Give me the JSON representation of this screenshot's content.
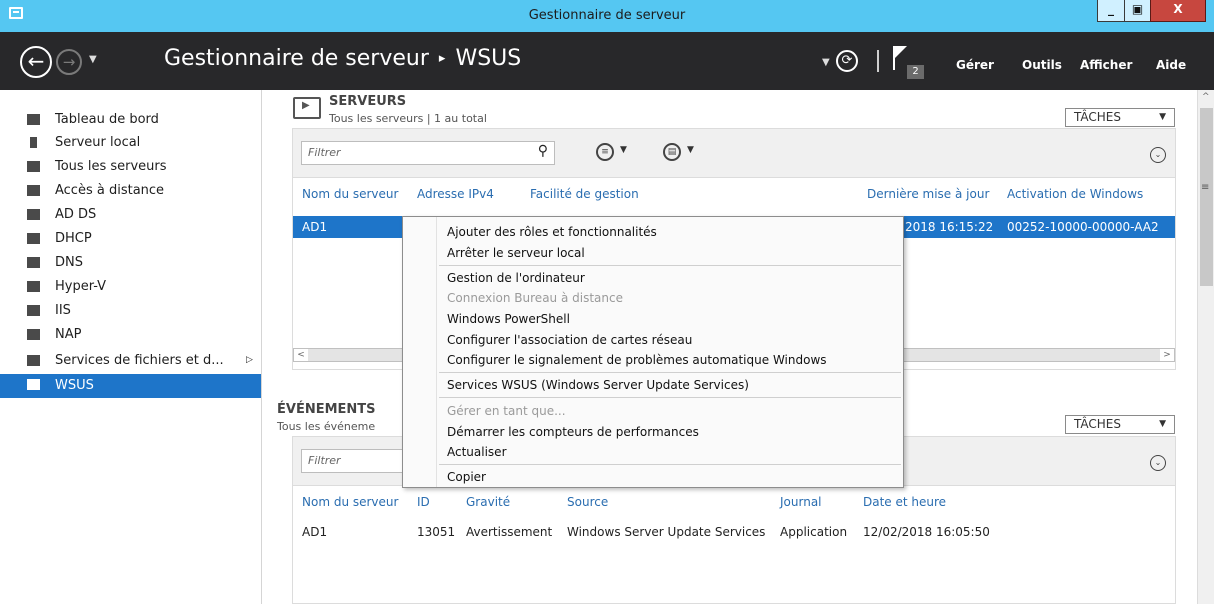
{
  "window": {
    "title": "Gestionnaire de serveur",
    "min": "_",
    "max": "▣",
    "close": "X"
  },
  "header": {
    "back": "←",
    "forward": "→",
    "caret": "▼",
    "breadcrumb_root": "Gestionnaire de serveur",
    "breadcrumb_sep": "▸",
    "breadcrumb_current": "WSUS",
    "refresh": "⟳",
    "notif_count": "2",
    "menu": {
      "manage": "Gérer",
      "tools": "Outils",
      "view": "Afficher",
      "help": "Aide"
    }
  },
  "sidebar": {
    "items": [
      {
        "label": "Tableau de bord"
      },
      {
        "label": "Serveur local"
      },
      {
        "label": "Tous les serveurs"
      },
      {
        "label": "Accès à distance"
      },
      {
        "label": "AD DS"
      },
      {
        "label": "DHCP"
      },
      {
        "label": "DNS"
      },
      {
        "label": "Hyper-V"
      },
      {
        "label": "IIS"
      },
      {
        "label": "NAP"
      },
      {
        "label": "Services de fichiers et d...",
        "arrow": "▷"
      },
      {
        "label": "WSUS"
      }
    ]
  },
  "servers": {
    "title": "SERVEURS",
    "subtitle": "Tous les serveurs | 1 au total",
    "tasks": "TÂCHES",
    "filter_placeholder": "Filtrer",
    "columns": [
      "Nom du serveur",
      "Adresse IPv4",
      "Facilité de gestion",
      "Dernière mise à jour",
      "Activation de Windows"
    ],
    "rows": [
      {
        "name": "AD1",
        "updated": "2018 16:15:22",
        "activation": "00252-10000-00000-AA2"
      }
    ]
  },
  "events": {
    "title": "ÉVÉNEMENTS",
    "subtitle": "Tous les événeme",
    "tasks": "TÂCHES",
    "filter_placeholder": "Filtrer",
    "columns": [
      "Nom du serveur",
      "ID",
      "Gravité",
      "Source",
      "Journal",
      "Date et heure"
    ],
    "rows": [
      {
        "name": "AD1",
        "id": "13051",
        "severity": "Avertissement",
        "source": "Windows Server Update Services",
        "log": "Application",
        "date": "12/02/2018 16:05:50"
      }
    ]
  },
  "context_menu": {
    "items": [
      {
        "label": "Ajouter des rôles et fonctionnalités"
      },
      {
        "label": "Arrêter le serveur local"
      },
      {
        "label": "Gestion de l'ordinateur"
      },
      {
        "label": "Connexion Bureau à distance",
        "disabled": true
      },
      {
        "label": "Windows PowerShell"
      },
      {
        "label": "Configurer l'association de cartes réseau"
      },
      {
        "label": "Configurer le signalement de problèmes automatique Windows"
      },
      {
        "label": "Services WSUS (Windows Server Update Services)"
      },
      {
        "label": "Gérer en tant que...",
        "disabled": true
      },
      {
        "label": "Démarrer les compteurs de performances"
      },
      {
        "label": "Actualiser"
      },
      {
        "label": "Copier"
      }
    ]
  },
  "colors": {
    "titlebar": "#55c7f2",
    "header": "#28282a",
    "accent": "#1e75c9",
    "link": "#2a6db0"
  }
}
